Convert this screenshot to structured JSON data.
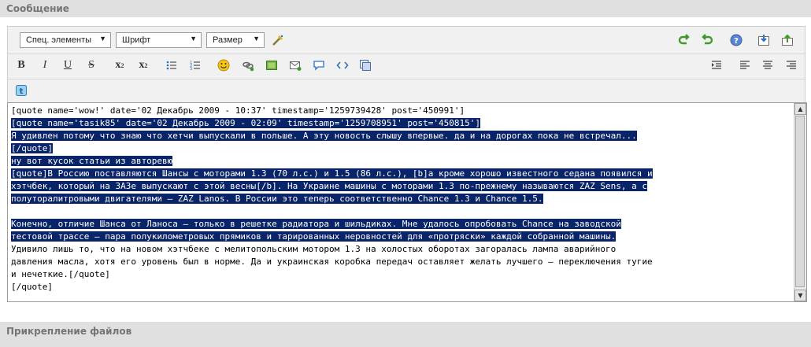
{
  "section_title": "Сообщение",
  "attachments_title": "Прикрепление файлов",
  "toolbar": {
    "special_elements": "Спец. элементы",
    "font": "Шрифт",
    "size": "Размер",
    "bold": "B",
    "italic": "I",
    "underline": "U",
    "strike": "S",
    "subscript": "x",
    "subscript_mark": "2",
    "superscript": "x",
    "superscript_mark": "2"
  },
  "editor": {
    "lines": [
      "[quote name='wow!' date='02 Декабрь 2009 - 10:37' timestamp='1259739428' post='450991']",
      "[quote name='tasik85' date='02 Декабрь 2009 - 02:09' timestamp='1259708951' post='450815']",
      "Я удивлен потому что знаю что хетчи выпускали в польше. А эту новость слышу впервые. да и на дорогах пока не встречал...",
      "[/quote]",
      "ну вот кусок статьи из авторевю",
      "[quote]В Россию поставляются Шансы с моторами 1.3 (70 л.с.) и 1.5 (86 л.с.), [b]а кроме хорошо известного седана появился и",
      "хэтчбек, который на ЗАЗе выпускают с этой весны[/b]. На Украине машины с моторами 1.3 по-прежнему называются ZAZ Sens, а с",
      "полуторалитровыми двигателями — ZAZ Lanos. В России это теперь соответственно Chance 1.3 и Chance 1.5.",
      "",
      "Конечно, отличие Шанса от Ланоса — только в решетке радиатора и шильдиках. Мне удалось опробовать Chance на заводской",
      "тестовой трассе — пара полукилометровых прямиков и тарированных неровностей для «протряски» каждой собранной машины.",
      "Удивило лишь то, что на новом хэтчбеке с мелитопольским мотором 1.3 на холостых оборотах загоралась лампа аварийного",
      "давления масла, хотя его уровень был в норме. Да и украинская коробка передач оставляет желать лучшего — переключения тугие",
      "и нечеткие.[/quote]",
      "[/quote]"
    ],
    "selected_lines": [
      1,
      2,
      3,
      4,
      5,
      6,
      7,
      9,
      10
    ]
  },
  "colors": {
    "selection": "#0a246a",
    "header_bg": "#e0e0e0",
    "toolbar_bg": "#f1f1f1",
    "icon_green": "#3f9a2a",
    "icon_blue": "#2f6fc0"
  },
  "icons": [
    "wand-icon",
    "undo-icon",
    "redo-icon",
    "help-icon",
    "save-icon",
    "upload-icon",
    "smiley-icon",
    "link-icon",
    "image-icon",
    "email-icon",
    "comment-icon",
    "code-icon",
    "media-icon",
    "indent-icon",
    "align-left-icon",
    "align-center-icon",
    "align-right-icon",
    "twitter-icon"
  ]
}
